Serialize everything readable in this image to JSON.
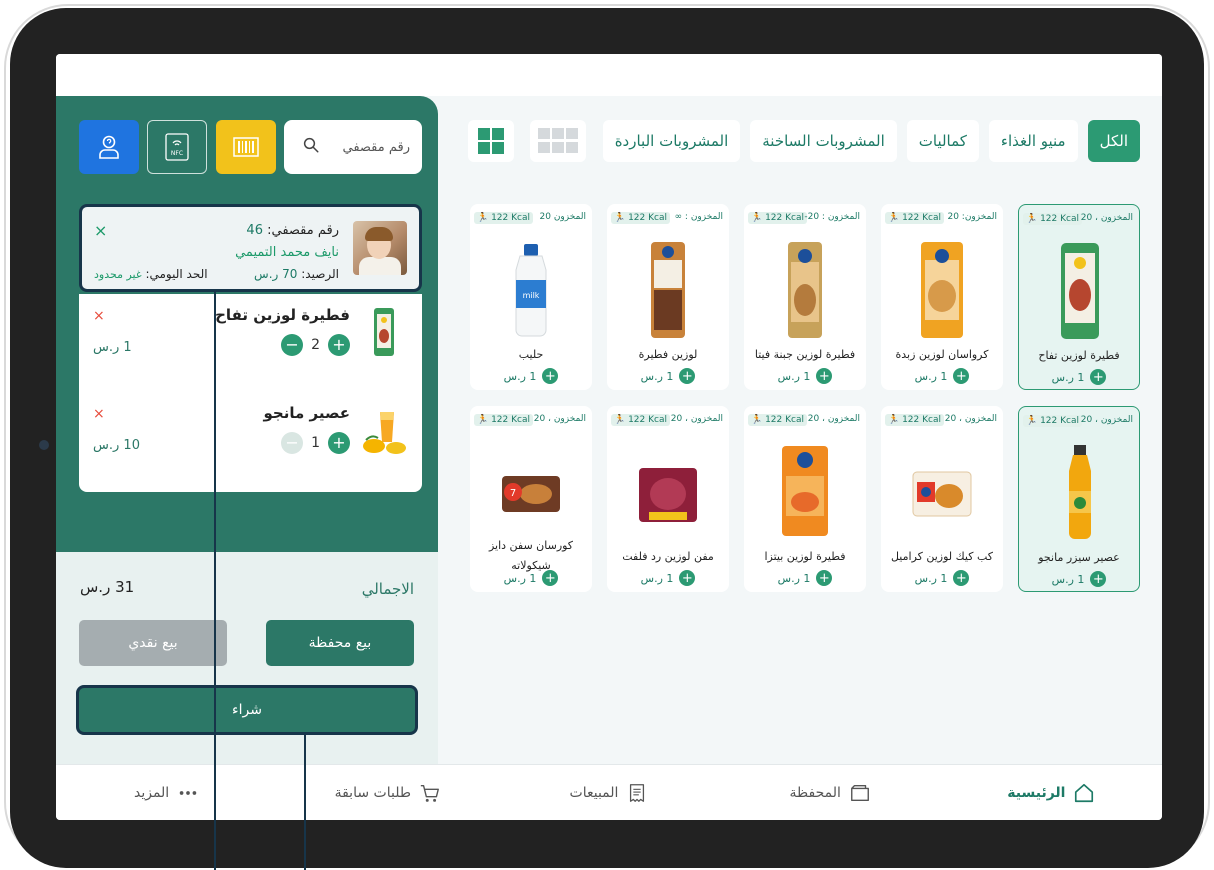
{
  "categories": [
    "الكل",
    "منيو الغذاء",
    "كماليات",
    "المشروبات الساخنة",
    "المشروبات الباردة"
  ],
  "active_category": "الكل",
  "search": {
    "placeholder": "رقم مقصفي"
  },
  "tools": {
    "nfc_label": "NFC"
  },
  "student": {
    "id_label": "رقم مقصفي:",
    "id_value": "46",
    "name": "نايف محمد التميمي",
    "balance_label": "الرصيد:",
    "balance_value": "70 ر.س",
    "limit_label": "الحد اليومي:",
    "limit_value": "غير محدود",
    "close": "×"
  },
  "cart": [
    {
      "name": "فطيرة لوزين تفاح",
      "qty": "2",
      "price": "1 ر.س",
      "remove": "×"
    },
    {
      "name": "عصير مانجو",
      "qty": "1",
      "price": "10 ر.س",
      "remove": "×"
    }
  ],
  "summary": {
    "total_label": "الاجمالي",
    "total_value": "31 ر.س",
    "wallet_button": "بيع محفظة",
    "cash_button": "بيع نقدي",
    "buy_button": "شراء"
  },
  "products": [
    {
      "name": "فطيرة لوزين تفاح",
      "stock": "المخزون ، 20",
      "kcal": "122 Kcal",
      "price": "1 ر.س"
    },
    {
      "name": "كرواسان لوزين زبدة",
      "stock": "المخزون: 20",
      "kcal": "122 Kcal",
      "price": "1 ر.س"
    },
    {
      "name": "فطيرة لوزين جبنة فيتا",
      "stock": "المخزون : 20-",
      "kcal": "122 Kcal",
      "price": "1 ر.س"
    },
    {
      "name": "لوزين فطيرة",
      "stock": "المخزون : ∞",
      "kcal": "122 Kcal",
      "price": "1 ر.س"
    },
    {
      "name": "حليب",
      "stock": "المخزون 20",
      "kcal": "122 Kcal",
      "price": "1 ر.س"
    },
    {
      "name": "عصير سيزر مانجو",
      "stock": "المخزون ، 20",
      "kcal": "122 Kcal",
      "price": "1 ر.س"
    },
    {
      "name": "كب كيك لوزين كراميل",
      "stock": "المخزون ، 20",
      "kcal": "122 Kcal",
      "price": "1 ر.س"
    },
    {
      "name": "فطيرة لوزين بيتزا",
      "stock": "المخزون ، 20",
      "kcal": "122 Kcal",
      "price": "1 ر.س"
    },
    {
      "name": "مفن لوزين رد فلفت",
      "stock": "المخزون ، 20",
      "kcal": "122 Kcal",
      "price": "1 ر.س"
    },
    {
      "name": "كورسان سفن دايز شيكولاته",
      "stock": "المخزون ، 20",
      "kcal": "122 Kcal",
      "price": "1 ر.س"
    }
  ],
  "nav": {
    "home": "الرئيسية",
    "wallet": "المحفظة",
    "sales": "المبيعات",
    "orders": "طلبات سابقة",
    "more": "المزيد"
  },
  "colors": {
    "primary": "#2c7867",
    "accent": "#2c9a73",
    "highlight": "#17354a"
  }
}
